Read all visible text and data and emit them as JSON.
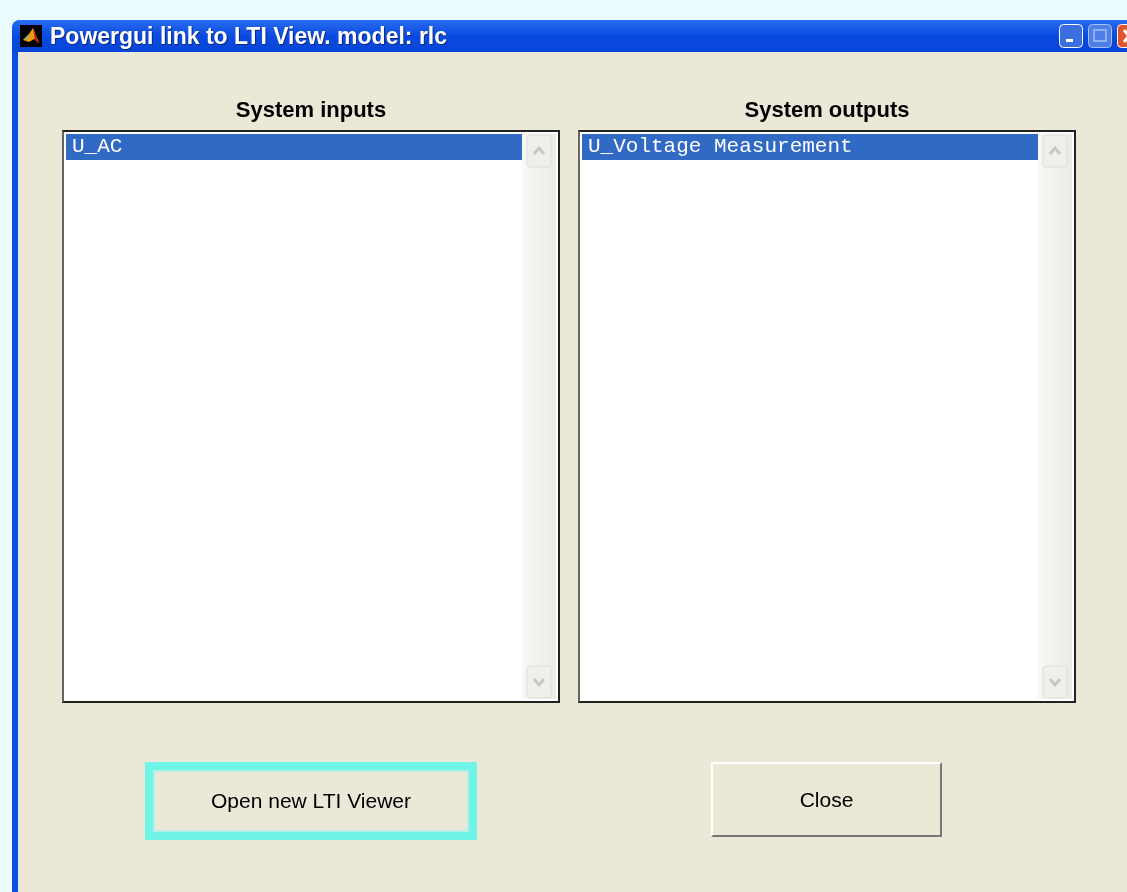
{
  "window": {
    "title": "Powergui link to LTI View. model: rlc"
  },
  "lists": [
    {
      "heading": "System inputs",
      "items": [
        {
          "label": "U_AC",
          "selected": true
        }
      ]
    },
    {
      "heading": "System outputs",
      "items": [
        {
          "label": "U_Voltage Measurement",
          "selected": true
        }
      ]
    }
  ],
  "buttons": [
    {
      "label": "Open new LTI Viewer",
      "focused": true
    },
    {
      "label": "Close",
      "focused": false
    }
  ]
}
